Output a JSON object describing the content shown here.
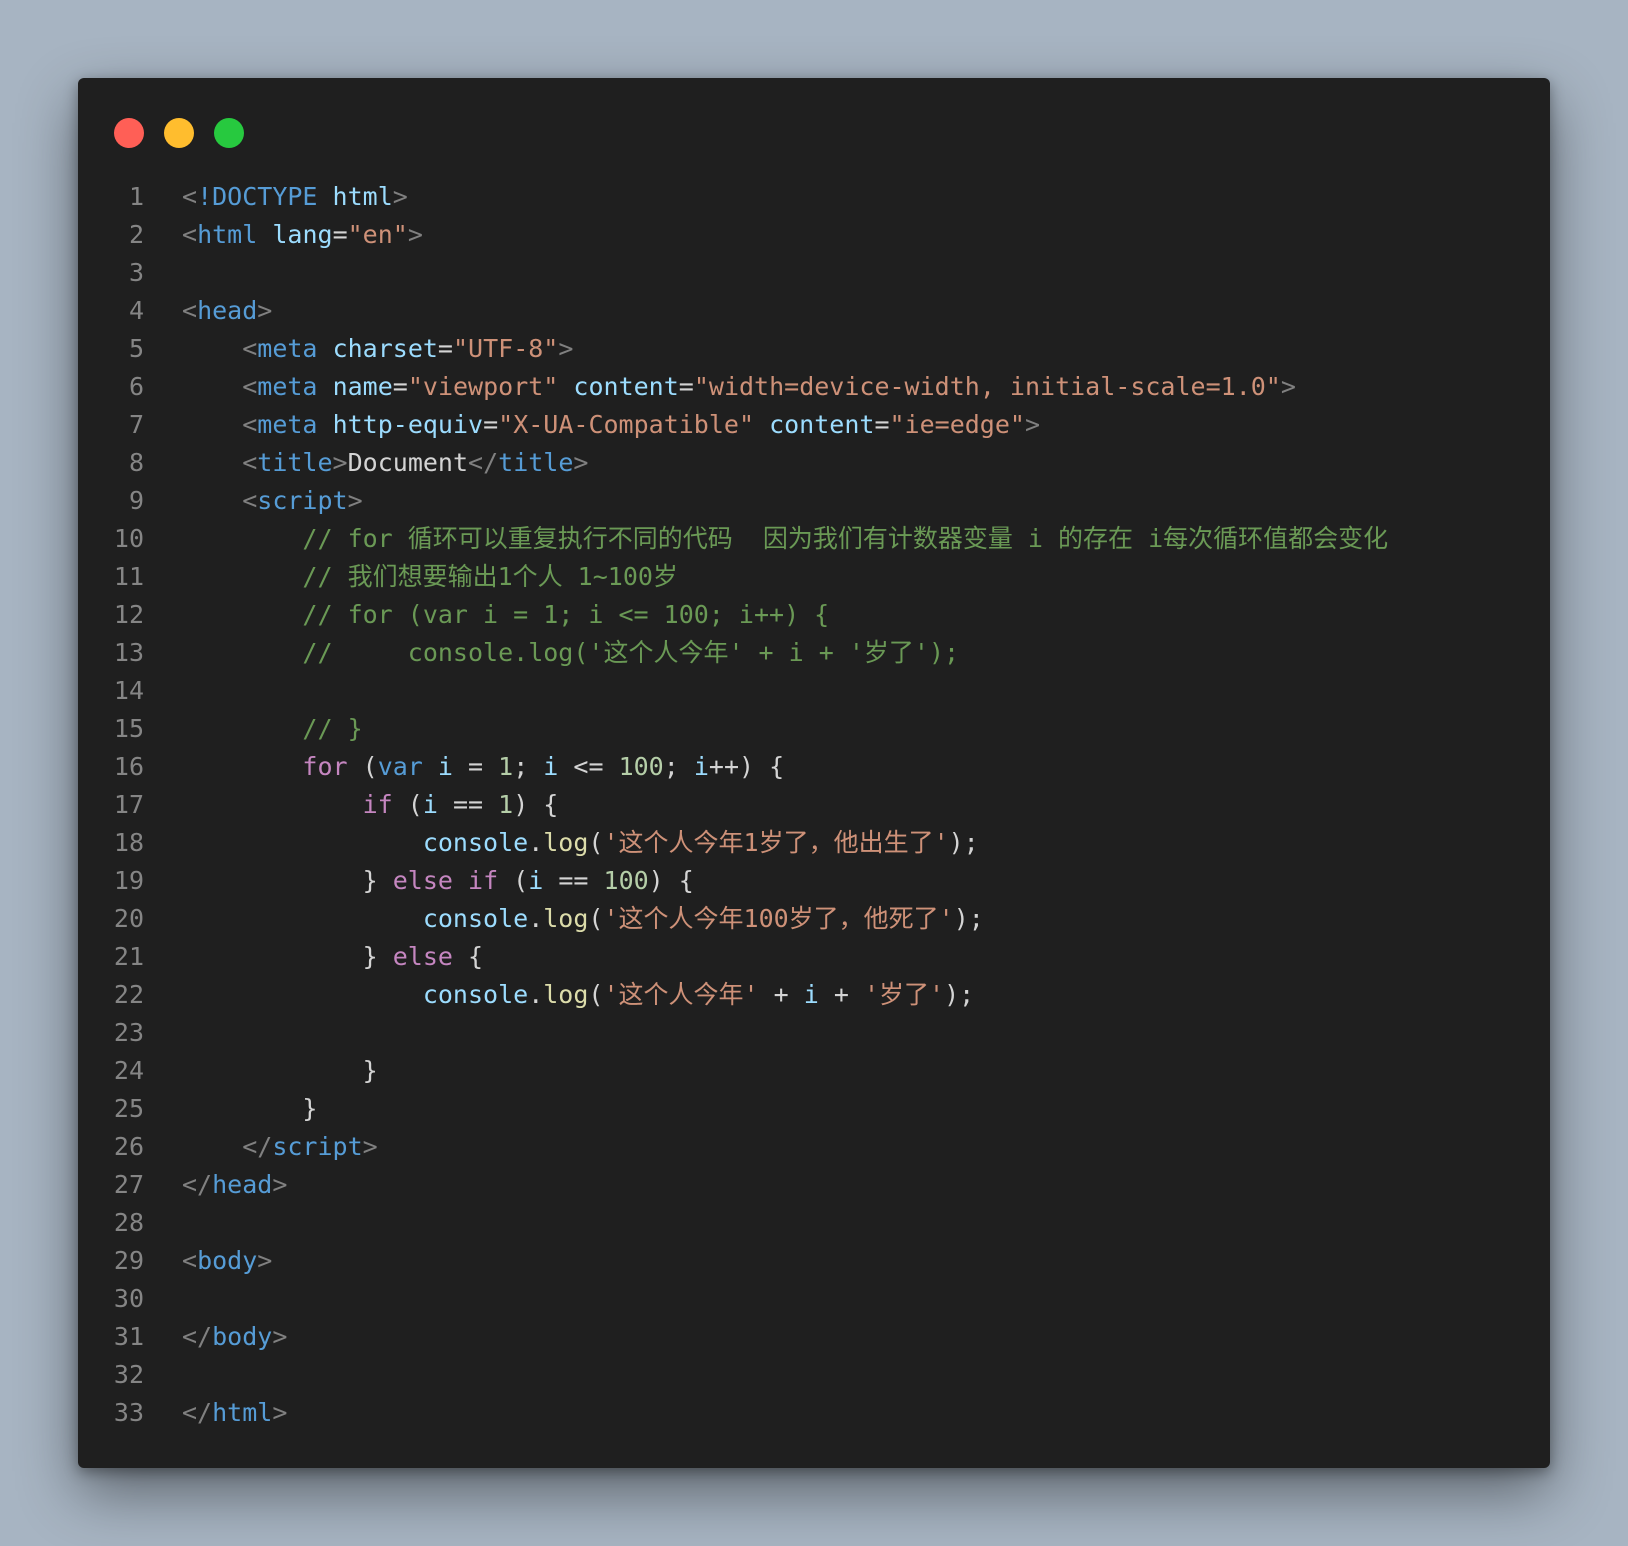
{
  "window": {
    "controls": [
      {
        "name": "close",
        "color": "#ff5f56"
      },
      {
        "name": "minimize",
        "color": "#ffbd2e"
      },
      {
        "name": "maximize",
        "color": "#27c93f"
      }
    ]
  },
  "code": {
    "lines": [
      {
        "n": "1",
        "tokens": [
          [
            "punct",
            "<"
          ],
          [
            "tag",
            "!DOCTYPE"
          ],
          [
            "text",
            " "
          ],
          [
            "attr",
            "html"
          ],
          [
            "punct",
            ">"
          ]
        ]
      },
      {
        "n": "2",
        "tokens": [
          [
            "punct",
            "<"
          ],
          [
            "tag",
            "html"
          ],
          [
            "text",
            " "
          ],
          [
            "attr",
            "lang"
          ],
          [
            "text",
            "="
          ],
          [
            "str",
            "\"en\""
          ],
          [
            "punct",
            ">"
          ]
        ]
      },
      {
        "n": "3",
        "tokens": []
      },
      {
        "n": "4",
        "tokens": [
          [
            "punct",
            "<"
          ],
          [
            "tag",
            "head"
          ],
          [
            "punct",
            ">"
          ]
        ]
      },
      {
        "n": "5",
        "tokens": [
          [
            "text",
            "    "
          ],
          [
            "punct",
            "<"
          ],
          [
            "tag",
            "meta"
          ],
          [
            "text",
            " "
          ],
          [
            "attr",
            "charset"
          ],
          [
            "text",
            "="
          ],
          [
            "str",
            "\"UTF-8\""
          ],
          [
            "punct",
            ">"
          ]
        ]
      },
      {
        "n": "6",
        "tokens": [
          [
            "text",
            "    "
          ],
          [
            "punct",
            "<"
          ],
          [
            "tag",
            "meta"
          ],
          [
            "text",
            " "
          ],
          [
            "attr",
            "name"
          ],
          [
            "text",
            "="
          ],
          [
            "str",
            "\"viewport\""
          ],
          [
            "text",
            " "
          ],
          [
            "attr",
            "content"
          ],
          [
            "text",
            "="
          ],
          [
            "str",
            "\"width=device-width, initial-scale=1.0\""
          ],
          [
            "punct",
            ">"
          ]
        ]
      },
      {
        "n": "7",
        "tokens": [
          [
            "text",
            "    "
          ],
          [
            "punct",
            "<"
          ],
          [
            "tag",
            "meta"
          ],
          [
            "text",
            " "
          ],
          [
            "attr",
            "http-equiv"
          ],
          [
            "text",
            "="
          ],
          [
            "str",
            "\"X-UA-Compatible\""
          ],
          [
            "text",
            " "
          ],
          [
            "attr",
            "content"
          ],
          [
            "text",
            "="
          ],
          [
            "str",
            "\"ie=edge\""
          ],
          [
            "punct",
            ">"
          ]
        ]
      },
      {
        "n": "8",
        "tokens": [
          [
            "text",
            "    "
          ],
          [
            "punct",
            "<"
          ],
          [
            "tag",
            "title"
          ],
          [
            "punct",
            ">"
          ],
          [
            "text",
            "Document"
          ],
          [
            "punct",
            "</"
          ],
          [
            "tag",
            "title"
          ],
          [
            "punct",
            ">"
          ]
        ]
      },
      {
        "n": "9",
        "tokens": [
          [
            "text",
            "    "
          ],
          [
            "punct",
            "<"
          ],
          [
            "tag",
            "script"
          ],
          [
            "punct",
            ">"
          ]
        ]
      },
      {
        "n": "10",
        "tokens": [
          [
            "text",
            "        "
          ],
          [
            "comment",
            "// for 循环可以重复执行不同的代码  因为我们有计数器变量 i 的存在 i每次循环值都会变化"
          ]
        ]
      },
      {
        "n": "11",
        "tokens": [
          [
            "text",
            "        "
          ],
          [
            "comment",
            "// 我们想要输出1个人 1~100岁"
          ]
        ]
      },
      {
        "n": "12",
        "tokens": [
          [
            "text",
            "        "
          ],
          [
            "comment",
            "// for (var i = 1; i <= 100; i++) {"
          ]
        ]
      },
      {
        "n": "13",
        "tokens": [
          [
            "text",
            "        "
          ],
          [
            "comment",
            "//     console.log('这个人今年' + i + '岁了');"
          ]
        ]
      },
      {
        "n": "14",
        "tokens": []
      },
      {
        "n": "15",
        "tokens": [
          [
            "text",
            "        "
          ],
          [
            "comment",
            "// }"
          ]
        ]
      },
      {
        "n": "16",
        "tokens": [
          [
            "text",
            "        "
          ],
          [
            "kw",
            "for"
          ],
          [
            "op",
            " ("
          ],
          [
            "decl",
            "var"
          ],
          [
            "op",
            " "
          ],
          [
            "var",
            "i"
          ],
          [
            "op",
            " = "
          ],
          [
            "num",
            "1"
          ],
          [
            "op",
            "; "
          ],
          [
            "var",
            "i"
          ],
          [
            "op",
            " <= "
          ],
          [
            "num",
            "100"
          ],
          [
            "op",
            "; "
          ],
          [
            "var",
            "i"
          ],
          [
            "op",
            "++) {"
          ]
        ]
      },
      {
        "n": "17",
        "tokens": [
          [
            "text",
            "            "
          ],
          [
            "kw",
            "if"
          ],
          [
            "op",
            " ("
          ],
          [
            "var",
            "i"
          ],
          [
            "op",
            " == "
          ],
          [
            "num",
            "1"
          ],
          [
            "op",
            ") {"
          ]
        ]
      },
      {
        "n": "18",
        "tokens": [
          [
            "text",
            "                "
          ],
          [
            "var",
            "console"
          ],
          [
            "op",
            "."
          ],
          [
            "fn",
            "log"
          ],
          [
            "op",
            "("
          ],
          [
            "str",
            "'这个人今年1岁了，他出生了'"
          ],
          [
            "op",
            ");"
          ]
        ]
      },
      {
        "n": "19",
        "tokens": [
          [
            "text",
            "            "
          ],
          [
            "op",
            "} "
          ],
          [
            "kw",
            "else"
          ],
          [
            "op",
            " "
          ],
          [
            "kw",
            "if"
          ],
          [
            "op",
            " ("
          ],
          [
            "var",
            "i"
          ],
          [
            "op",
            " == "
          ],
          [
            "num",
            "100"
          ],
          [
            "op",
            ") {"
          ]
        ]
      },
      {
        "n": "20",
        "tokens": [
          [
            "text",
            "                "
          ],
          [
            "var",
            "console"
          ],
          [
            "op",
            "."
          ],
          [
            "fn",
            "log"
          ],
          [
            "op",
            "("
          ],
          [
            "str",
            "'这个人今年100岁了，他死了'"
          ],
          [
            "op",
            ");"
          ]
        ]
      },
      {
        "n": "21",
        "tokens": [
          [
            "text",
            "            "
          ],
          [
            "op",
            "} "
          ],
          [
            "kw",
            "else"
          ],
          [
            "op",
            " {"
          ]
        ]
      },
      {
        "n": "22",
        "tokens": [
          [
            "text",
            "                "
          ],
          [
            "var",
            "console"
          ],
          [
            "op",
            "."
          ],
          [
            "fn",
            "log"
          ],
          [
            "op",
            "("
          ],
          [
            "str",
            "'这个人今年'"
          ],
          [
            "op",
            " + "
          ],
          [
            "var",
            "i"
          ],
          [
            "op",
            " + "
          ],
          [
            "str",
            "'岁了'"
          ],
          [
            "op",
            ");"
          ]
        ]
      },
      {
        "n": "23",
        "tokens": []
      },
      {
        "n": "24",
        "tokens": [
          [
            "text",
            "            "
          ],
          [
            "op",
            "}"
          ]
        ]
      },
      {
        "n": "25",
        "tokens": [
          [
            "text",
            "        "
          ],
          [
            "op",
            "}"
          ]
        ]
      },
      {
        "n": "26",
        "tokens": [
          [
            "text",
            "    "
          ],
          [
            "punct",
            "</"
          ],
          [
            "tag",
            "script"
          ],
          [
            "punct",
            ">"
          ]
        ]
      },
      {
        "n": "27",
        "tokens": [
          [
            "punct",
            "</"
          ],
          [
            "tag",
            "head"
          ],
          [
            "punct",
            ">"
          ]
        ]
      },
      {
        "n": "28",
        "tokens": []
      },
      {
        "n": "29",
        "tokens": [
          [
            "punct",
            "<"
          ],
          [
            "tag",
            "body"
          ],
          [
            "punct",
            ">"
          ]
        ]
      },
      {
        "n": "30",
        "tokens": []
      },
      {
        "n": "31",
        "tokens": [
          [
            "punct",
            "</"
          ],
          [
            "tag",
            "body"
          ],
          [
            "punct",
            ">"
          ]
        ]
      },
      {
        "n": "32",
        "tokens": []
      },
      {
        "n": "33",
        "tokens": [
          [
            "punct",
            "</"
          ],
          [
            "tag",
            "html"
          ],
          [
            "punct",
            ">"
          ]
        ]
      }
    ]
  }
}
